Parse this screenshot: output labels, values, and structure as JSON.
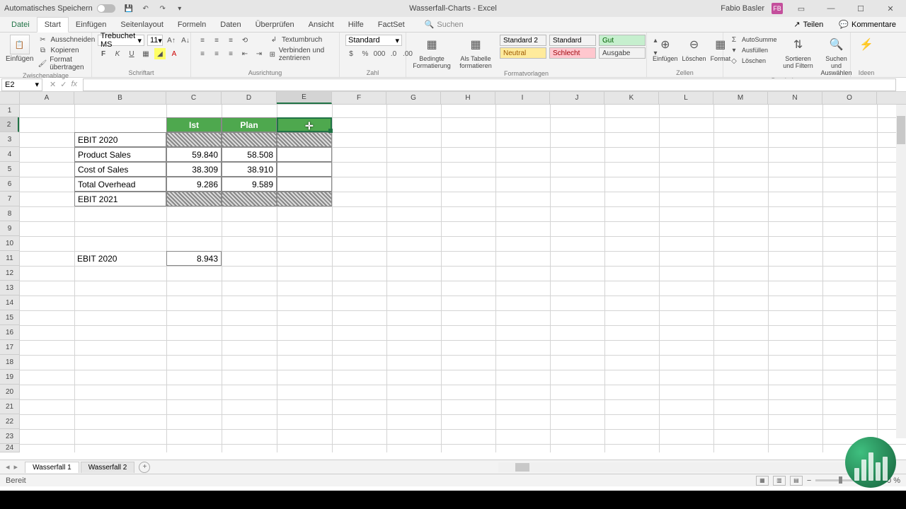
{
  "titlebar": {
    "autosave": "Automatisches Speichern",
    "title": "Wasserfall-Charts - Excel",
    "username": "Fabio Basler",
    "user_initial": "FB"
  },
  "tabs": {
    "file": "Datei",
    "start": "Start",
    "einfuegen": "Einfügen",
    "seitenlayout": "Seitenlayout",
    "formeln": "Formeln",
    "daten": "Daten",
    "ueberpruefen": "Überprüfen",
    "ansicht": "Ansicht",
    "hilfe": "Hilfe",
    "factset": "FactSet",
    "suchen": "Suchen",
    "teilen": "Teilen",
    "kommentare": "Kommentare"
  },
  "ribbon": {
    "zwischenablage": {
      "label": "Zwischenablage",
      "einfuegen": "Einfügen",
      "ausschneiden": "Ausschneiden",
      "kopieren": "Kopieren",
      "format_uebertragen": "Format übertragen"
    },
    "schriftart": {
      "label": "Schriftart",
      "font": "Trebuchet MS",
      "size": "11"
    },
    "ausrichtung": {
      "label": "Ausrichtung",
      "textumbruch": "Textumbruch",
      "verbinden": "Verbinden und zentrieren"
    },
    "zahl": {
      "label": "Zahl",
      "format": "Standard"
    },
    "formatvorlagen": {
      "label": "Formatvorlagen",
      "bedingte": "Bedingte Formatierung",
      "als_tabelle": "Als Tabelle formatieren",
      "standard2": "Standard 2",
      "standard": "Standard",
      "gut": "Gut",
      "neutral": "Neutral",
      "schlecht": "Schlecht",
      "ausgabe": "Ausgabe"
    },
    "zellen": {
      "label": "Zellen",
      "einfuegen": "Einfügen",
      "loeschen": "Löschen",
      "format": "Format"
    },
    "bearbeiten": {
      "label": "Bearbeiten",
      "autosumme": "AutoSumme",
      "ausfuellen": "Ausfüllen",
      "loeschen": "Löschen",
      "sortieren": "Sortieren und Filtern",
      "suchen": "Suchen und Auswählen"
    },
    "ideen": {
      "label": "Ideen"
    }
  },
  "namebox": "E2",
  "columns": [
    "A",
    "B",
    "C",
    "D",
    "E",
    "F",
    "G",
    "H",
    "I",
    "J",
    "K",
    "L",
    "M",
    "N",
    "O"
  ],
  "table": {
    "header_ist": "Ist",
    "header_plan": "Plan",
    "rows": [
      {
        "label": "EBIT 2020"
      },
      {
        "label": "Product Sales",
        "ist": "59.840",
        "plan": "58.508"
      },
      {
        "label": "Cost of Sales",
        "ist": "38.309",
        "plan": "38.910"
      },
      {
        "label": "Total Overhead",
        "ist": "9.286",
        "plan": "9.589"
      },
      {
        "label": "EBIT 2021"
      }
    ]
  },
  "lower": {
    "label": "EBIT 2020",
    "value": "8.943"
  },
  "sheets": {
    "tab1": "Wasserfall 1",
    "tab2": "Wasserfall 2"
  },
  "status": {
    "bereit": "Bereit",
    "zoom": "100 %"
  }
}
